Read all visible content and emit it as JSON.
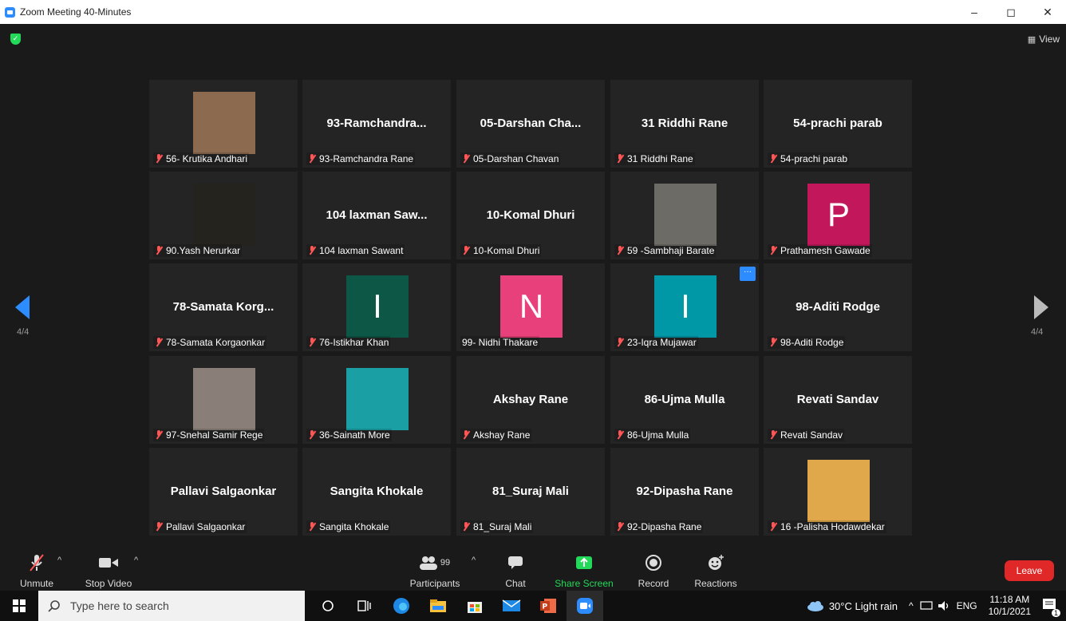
{
  "window": {
    "title": "Zoom Meeting 40-Minutes",
    "controls": [
      "–",
      "◻",
      "✕"
    ]
  },
  "header": {
    "view_label": "View",
    "shield": "✓"
  },
  "pagination": {
    "left": "4/4",
    "right": "4/4"
  },
  "tiles": [
    {
      "row": 0,
      "col": 0,
      "big": "",
      "name": "56- Krutika Andhari",
      "muted": true,
      "avatar": "photo",
      "color": "#8c6a4f"
    },
    {
      "row": 0,
      "col": 1,
      "big": "93-Ramchandra...",
      "name": "93-Ramchandra Rane",
      "muted": true
    },
    {
      "row": 0,
      "col": 2,
      "big": "05-Darshan  Cha...",
      "name": "05-Darshan Chavan",
      "muted": true
    },
    {
      "row": 0,
      "col": 3,
      "big": "31 Riddhi Rane",
      "name": "31 Riddhi Rane",
      "muted": true
    },
    {
      "row": 0,
      "col": 4,
      "big": "54-prachi parab",
      "name": "54-prachi parab",
      "muted": true
    },
    {
      "row": 1,
      "col": 0,
      "big": "",
      "name": "90.Yash Nerurkar",
      "muted": true,
      "avatar": "dark",
      "color": "#25231e"
    },
    {
      "row": 1,
      "col": 1,
      "big": "104 laxman Saw...",
      "name": "104 laxman Sawant",
      "muted": true
    },
    {
      "row": 1,
      "col": 2,
      "big": "10-Komal Dhuri",
      "name": "10-Komal Dhuri",
      "muted": true
    },
    {
      "row": 1,
      "col": 3,
      "big": "",
      "name": "59 -Sambhaji Barate",
      "muted": true,
      "avatar": "photo",
      "color": "#6d6b66"
    },
    {
      "row": 1,
      "col": 4,
      "big": "",
      "name": "Prathamesh Gawade",
      "muted": true,
      "avatar": "letter",
      "letter": "P",
      "color": "#c2185b"
    },
    {
      "row": 2,
      "col": 0,
      "big": "78-Samata  Korg...",
      "name": "78-Samata Korgaonkar",
      "muted": true
    },
    {
      "row": 2,
      "col": 1,
      "big": "",
      "name": "76-Istikhar Khan",
      "muted": true,
      "avatar": "letter",
      "letter": "I",
      "color": "#0d5746"
    },
    {
      "row": 2,
      "col": 2,
      "big": "",
      "name": "99- Nidhi Thakare",
      "muted": false,
      "avatar": "letter",
      "letter": "N",
      "color": "#e8407a"
    },
    {
      "row": 2,
      "col": 3,
      "big": "",
      "name": "23-Iqra Mujawar",
      "muted": true,
      "avatar": "letter",
      "letter": "I",
      "color": "#0097a7",
      "menu": "···"
    },
    {
      "row": 2,
      "col": 4,
      "big": "98-Aditi Rodge",
      "name": "98-Aditi Rodge",
      "muted": true
    },
    {
      "row": 3,
      "col": 0,
      "big": "",
      "name": "97-Snehal Samir Rege",
      "muted": true,
      "avatar": "photo",
      "color": "#8a7f78"
    },
    {
      "row": 3,
      "col": 1,
      "big": "",
      "name": "36-Sainath More",
      "muted": true,
      "avatar": "photo",
      "color": "#1a9fa4"
    },
    {
      "row": 3,
      "col": 2,
      "big": "Akshay Rane",
      "name": "Akshay Rane",
      "muted": true
    },
    {
      "row": 3,
      "col": 3,
      "big": "86-Ujma Mulla",
      "name": "86-Ujma Mulla",
      "muted": true
    },
    {
      "row": 3,
      "col": 4,
      "big": "Revati Sandav",
      "name": "Revati Sandav",
      "muted": true
    },
    {
      "row": 4,
      "col": 0,
      "big": "Pallavi Salgaonkar",
      "name": "Pallavi Salgaonkar",
      "muted": true
    },
    {
      "row": 4,
      "col": 1,
      "big": "Sangita Khokale",
      "name": "Sangita Khokale",
      "muted": true
    },
    {
      "row": 4,
      "col": 2,
      "big": "81_Suraj Mali",
      "name": "81_Suraj Mali",
      "muted": true
    },
    {
      "row": 4,
      "col": 3,
      "big": "92-Dipasha Rane",
      "name": "92-Dipasha Rane",
      "muted": true
    },
    {
      "row": 4,
      "col": 4,
      "big": "",
      "name": "16 -Palisha Hodawdekar",
      "muted": true,
      "avatar": "photo",
      "color": "#e0a84a"
    }
  ],
  "toolbar": {
    "unmute": "Unmute",
    "stop_video": "Stop Video",
    "participants": "Participants",
    "participants_count": "99",
    "chat": "Chat",
    "share_screen": "Share Screen",
    "record": "Record",
    "reactions": "Reactions",
    "leave": "Leave"
  },
  "taskbar": {
    "search_placeholder": "Type here to search",
    "weather": "30°C  Light rain",
    "lang": "ENG",
    "time": "11:18 AM",
    "date": "10/1/2021",
    "notif_count": "1"
  },
  "colors": {
    "accent": "#2d8cff",
    "muted": "#ff5555",
    "share": "#23d959",
    "leave": "#e02828"
  }
}
